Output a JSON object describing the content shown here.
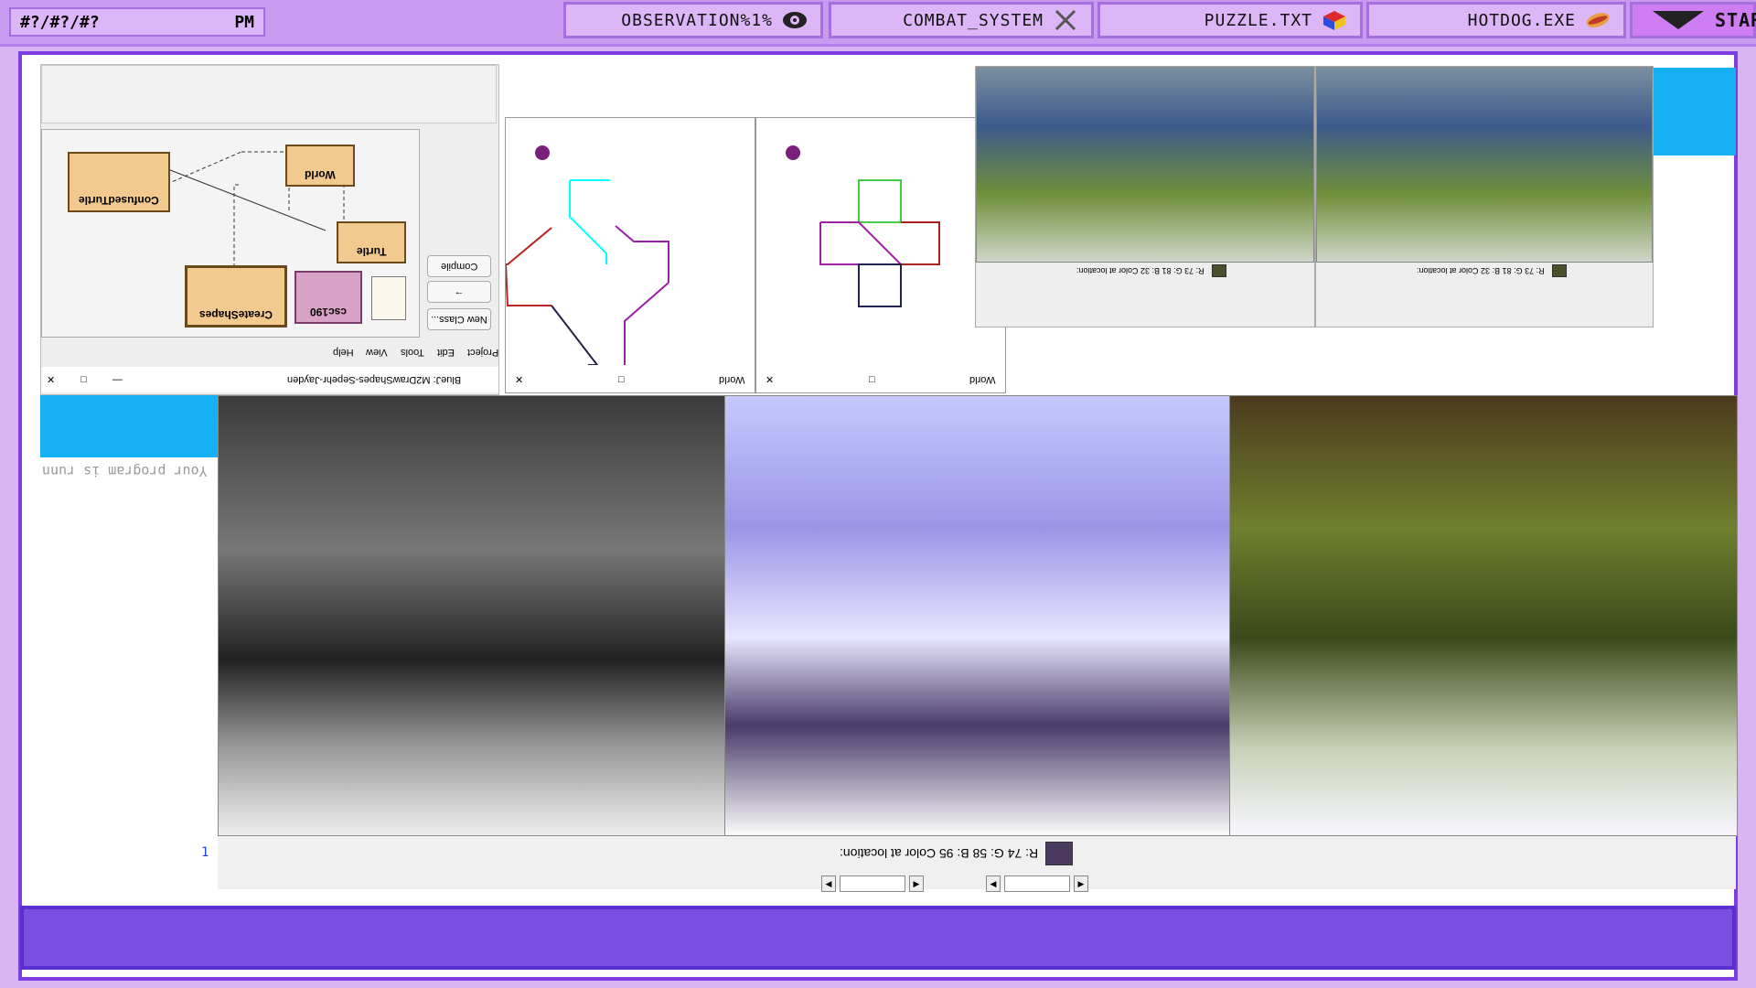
{
  "taskbar": {
    "start_label": "START",
    "apps": [
      {
        "label": "HOTDOG.EXE",
        "icon": "hotdog-icon"
      },
      {
        "label": "PUZZLE.TXT",
        "icon": "cube-icon"
      },
      {
        "label": "COMBAT_SYSTEM",
        "icon": "swords-icon"
      },
      {
        "label": "OBSERVATION%1%",
        "icon": "eye-icon"
      }
    ],
    "clock_time": "PM",
    "clock_prefix": "#?/#?/#?"
  },
  "bluej": {
    "title": "BlueJ: M2DrawShapes-Sepehr-Jayden",
    "menu": [
      "Project",
      "Edit",
      "Tools",
      "View",
      "Help"
    ],
    "buttons": [
      "New Class...",
      "Compile"
    ],
    "classes": [
      "ConfusedTurtle",
      "World",
      "Turtle",
      "CreateShapes",
      "csc190"
    ]
  },
  "world_windows": [
    {
      "title": "World"
    },
    {
      "title": "World"
    }
  ],
  "color_readout": {
    "text": "R: 74 G: 58 B: 95 Color at location:",
    "swatch": "#4a3a5f"
  },
  "mini_readouts": [
    {
      "text": "R: 73 G: 81 B: 32 Color at location:",
      "swatch": "#49512a"
    },
    {
      "text": "R: 73 G: 81 B: 32 Color at location:",
      "swatch": "#49512a"
    }
  ],
  "terminal": {
    "line": "Your program is runn",
    "corner": "1"
  },
  "colors": {
    "taskbar": "#c89af0",
    "frame": "#7b3fe0",
    "bottom_bar": "#7a4fe0",
    "accent_cyan": "#16b1f5"
  }
}
